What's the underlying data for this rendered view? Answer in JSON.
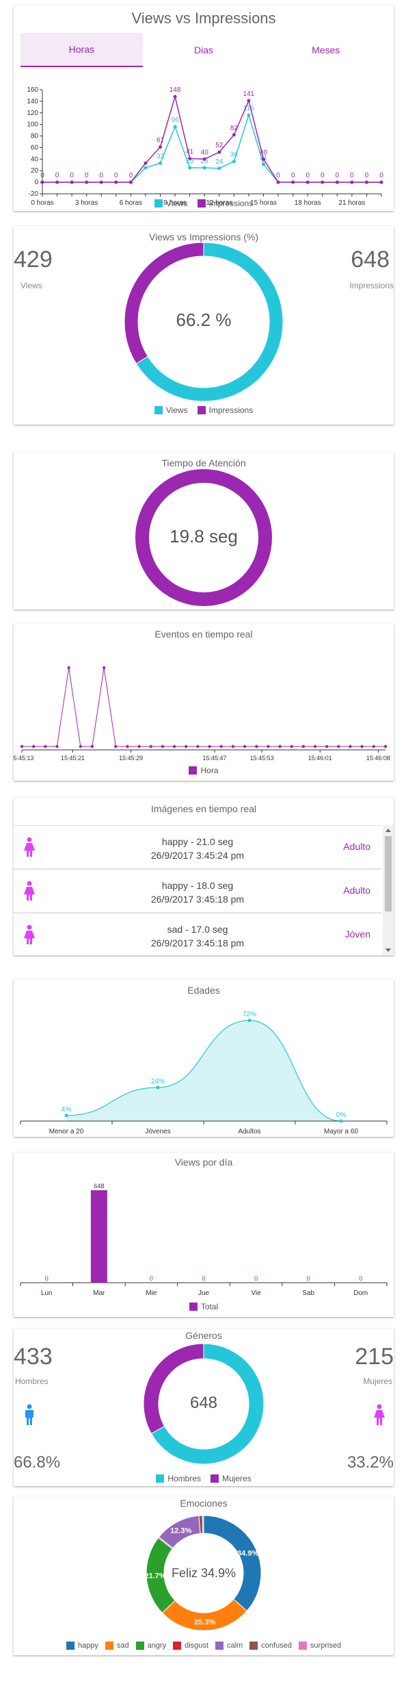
{
  "colors": {
    "views": "#26c6da",
    "impressions": "#9c27b0",
    "accent": "#9c27b0",
    "male": "#2196f3",
    "female": "#e040fb"
  },
  "card1": {
    "title": "Views vs Impressions",
    "tabs": [
      {
        "label": "Horas",
        "active": true
      },
      {
        "label": "Dias",
        "active": false
      },
      {
        "label": "Meses",
        "active": false
      }
    ],
    "legend": [
      "Views",
      "Impressions"
    ],
    "chart_data": {
      "type": "line",
      "x": [
        0,
        1,
        2,
        3,
        4,
        5,
        6,
        7,
        8,
        9,
        10,
        11,
        12,
        13,
        14,
        15,
        16,
        17,
        18,
        19,
        20,
        21,
        22,
        23
      ],
      "x_ticks": [
        "0 horas",
        "3 horas",
        "6 horas",
        "9 horas",
        "12 horas",
        "15 horas",
        "18 horas",
        "21 horas"
      ],
      "y_ticks": [
        "160",
        "140",
        "120",
        "100",
        "80",
        "60",
        "40",
        "20",
        "0",
        "-20"
      ],
      "ylim": [
        -20,
        160
      ],
      "series": [
        {
          "name": "Views",
          "values": [
            0,
            0,
            0,
            0,
            0,
            0,
            0,
            25,
            33,
            96,
            25,
            25,
            24,
            36,
            116,
            31,
            0,
            0,
            0,
            0,
            0,
            0,
            0,
            0
          ]
        },
        {
          "name": "Impressions",
          "values": [
            0,
            0,
            0,
            0,
            0,
            0,
            0,
            33,
            61,
            148,
            41,
            40,
            52,
            82,
            141,
            40,
            0,
            0,
            0,
            0,
            0,
            0,
            0,
            0
          ]
        }
      ],
      "labels_views": [
        "",
        "",
        "",
        "",
        "",
        "",
        "",
        "",
        "33",
        "96",
        "25",
        "25",
        "24",
        "36",
        "116",
        "31",
        "",
        "",
        "",
        "",
        "",
        "",
        "",
        ""
      ],
      "labels_impressions": [
        "0",
        "0",
        "0",
        "0",
        "0",
        "0",
        "0",
        "",
        "61",
        "148",
        "41",
        "40",
        "52",
        "82",
        "141",
        "40",
        "0",
        "0",
        "0",
        "0",
        "0",
        "0",
        "0",
        "0"
      ]
    }
  },
  "card2": {
    "title": "Views vs Impressions (%)",
    "left_value": "429",
    "left_label": "Views",
    "right_value": "648",
    "right_label": "Impressions",
    "center": "66.2 %",
    "legend": [
      "Views",
      "Impressions"
    ],
    "chart_data": {
      "type": "pie",
      "categories": [
        "Views",
        "Impressions"
      ],
      "values": [
        66.2,
        33.8
      ]
    }
  },
  "card3": {
    "title": "Tiempo de Atención",
    "center": "19.8 seg"
  },
  "card4": {
    "title": "Eventos en tiempo real",
    "legend": "Hora",
    "chart_data": {
      "type": "line",
      "x_ticks": [
        "15:45:13",
        "15:45:21",
        "15:45:29",
        "15:45:47",
        "15:45:53",
        "15:46:01",
        "15:46:08"
      ],
      "values": [
        0,
        0,
        0,
        0,
        1,
        0,
        0,
        1,
        0,
        0,
        0,
        0,
        0,
        0,
        0,
        0,
        0,
        0,
        0,
        0,
        0,
        0,
        0,
        0,
        0,
        0,
        0,
        0,
        0,
        0,
        0,
        0
      ]
    }
  },
  "card5": {
    "title": "Imágenes en tiempo real",
    "rows": [
      {
        "line1": "happy - 21.0 seg",
        "line2": "26/9/2017 3:45:24 pm",
        "category": "Adulto"
      },
      {
        "line1": "happy - 18.0 seg",
        "line2": "26/9/2017 3:45:18 pm",
        "category": "Adulto"
      },
      {
        "line1": "sad - 17.0 seg",
        "line2": "26/9/2017 3:45:18 pm",
        "category": "Jóven"
      }
    ]
  },
  "card6": {
    "title": "Edades",
    "chart_data": {
      "type": "area",
      "categories": [
        "Menor a 20",
        "Jóvenes",
        "Adultos",
        "Mayor a 60"
      ],
      "values": [
        4,
        24,
        72,
        0
      ],
      "labels": [
        "4%",
        "24%",
        "72%",
        "0%"
      ]
    }
  },
  "card7": {
    "title": "Views por día",
    "legend": "Total",
    "chart_data": {
      "type": "bar",
      "categories": [
        "Lun",
        "Mar",
        "Mie",
        "Jue",
        "Vie",
        "Sab",
        "Dom"
      ],
      "values": [
        0,
        648,
        0,
        0,
        0,
        0,
        0
      ]
    }
  },
  "card8": {
    "title": "Géneros",
    "left_value": "433",
    "left_label": "Hombres",
    "left_pct": "66.8%",
    "right_value": "215",
    "right_label": "Mujeres",
    "right_pct": "33.2%",
    "center": "648",
    "legend": [
      "Hombres",
      "Mujeres"
    ],
    "chart_data": {
      "type": "pie",
      "categories": [
        "Hombres",
        "Mujeres"
      ],
      "values": [
        66.8,
        33.2
      ]
    }
  },
  "card9": {
    "title": "Emociones",
    "center": "Feliz 34.9%",
    "legend": [
      "happy",
      "sad",
      "angry",
      "disgust",
      "calm",
      "confused",
      "surprised"
    ],
    "legend_colors": [
      "#1f77b4",
      "#ff7f0e",
      "#2ca02c",
      "#d62728",
      "#9467bd",
      "#8c564b",
      "#e377c2"
    ],
    "chart_data": {
      "type": "pie",
      "categories": [
        "happy",
        "sad",
        "angry",
        "disgust",
        "calm",
        "confused",
        "surprised"
      ],
      "values": [
        34.9,
        25.3,
        21.7,
        0.3,
        12.3,
        1.0,
        0.3
      ],
      "labels": [
        "34.9%",
        "25.3%",
        "21.7%",
        "",
        "12.3%",
        "",
        ""
      ]
    }
  }
}
